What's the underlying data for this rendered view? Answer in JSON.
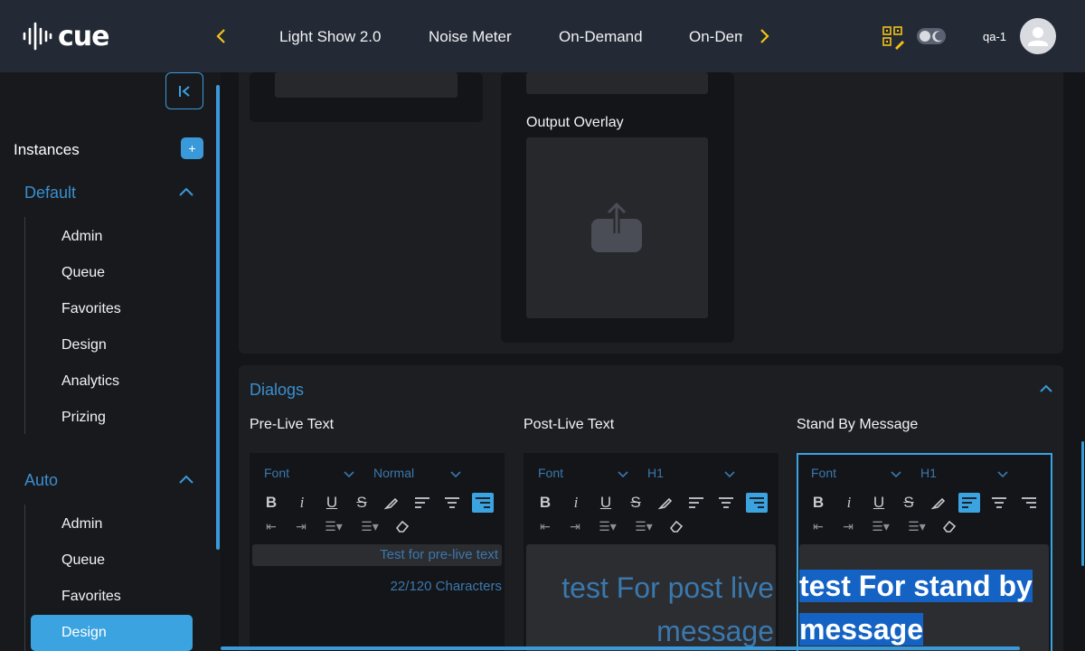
{
  "app": {
    "logo_text": "cue"
  },
  "nav": {
    "tabs": [
      "Light Show 2.0",
      "Noise Meter",
      "On-Demand",
      "On-Dem"
    ]
  },
  "user": {
    "name": "qa-1"
  },
  "sidebar": {
    "title": "Instances",
    "add_label": "+",
    "groups": [
      {
        "title": "Default",
        "items": [
          "Admin",
          "Queue",
          "Favorites",
          "Design",
          "Analytics",
          "Prizing"
        ]
      },
      {
        "title": "Auto",
        "items": [
          "Admin",
          "Queue",
          "Favorites",
          "Design"
        ],
        "active": "Design"
      }
    ]
  },
  "main": {
    "output_overlay_label": "Output Overlay",
    "dialogs": {
      "title": "Dialogs",
      "columns": [
        {
          "label": "Pre-Live Text",
          "font": "Font",
          "size": "Normal",
          "content": "Test for pre-live text",
          "char_count": "22/120 Characters",
          "align": "right"
        },
        {
          "label": "Post-Live Text",
          "font": "Font",
          "size": "H1",
          "content_line1": "test For post live",
          "content_line2": "message",
          "align": "right"
        },
        {
          "label": "Stand By Message",
          "font": "Font",
          "size": "H1",
          "content_line1": "test For stand by",
          "content_line2": "message",
          "align": "left",
          "selected": true
        }
      ]
    }
  },
  "colors": {
    "accent": "#3aa3e0",
    "nav_arrow": "#f3c417",
    "topbar": "#242a35",
    "link_text": "#3a78ad"
  }
}
